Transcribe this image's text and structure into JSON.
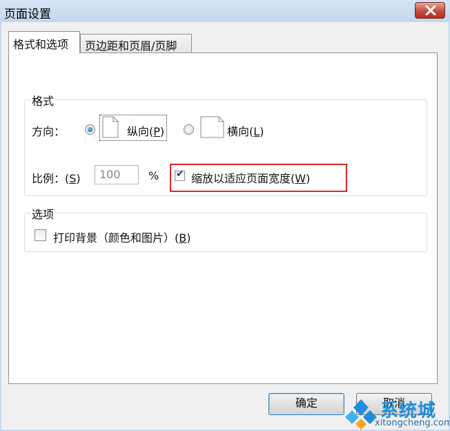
{
  "window": {
    "title": "页面设置"
  },
  "tabs": [
    {
      "label": "格式和选项",
      "active": true
    },
    {
      "label": "页边距和页眉/页脚",
      "active": false
    }
  ],
  "format_group": {
    "title": "格式",
    "orientation_label": "方向：",
    "portrait": {
      "label": "纵向",
      "key": "P",
      "checked": true
    },
    "landscape": {
      "label": "横向",
      "key": "L",
      "checked": false
    },
    "scale_label": "比例：",
    "scale_key": "S",
    "scale_value": "100",
    "scale_unit": "%",
    "shrink_to_fit": {
      "label": "缩放以适应页面宽度",
      "key": "W",
      "checked": true
    }
  },
  "options_group": {
    "title": "选项",
    "print_background": {
      "label": "打印背景（颜色和图片）",
      "key": "B",
      "checked": false
    }
  },
  "buttons": {
    "ok": "确定",
    "cancel": "取消"
  },
  "watermark": {
    "brand": "系统城",
    "url": "xitongcheng.com"
  },
  "colors": {
    "highlight": "#e0242a",
    "close_button": "#c64d3c",
    "frame": "#c6d9ee"
  }
}
